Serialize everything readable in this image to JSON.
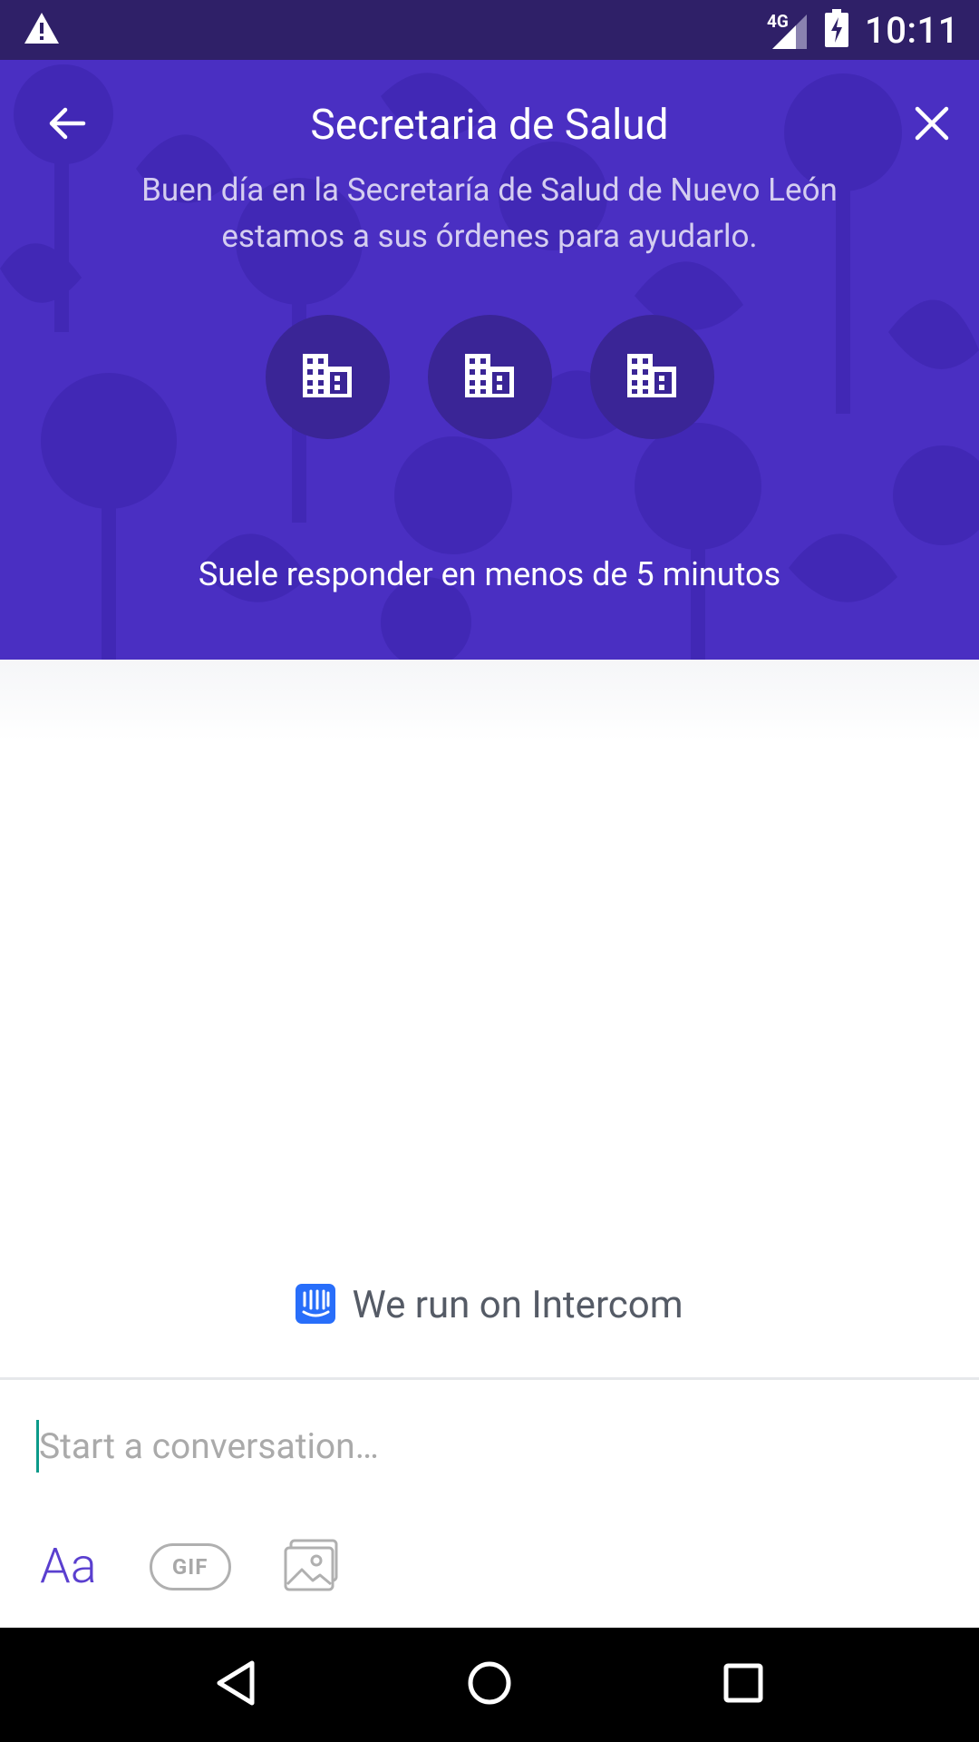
{
  "status_bar": {
    "time": "10:11",
    "network": "4G",
    "icons": [
      "warning-icon",
      "signal-icon",
      "battery-charging-icon"
    ]
  },
  "header": {
    "title": "Secretaria de Salud",
    "intro": "Buen día en la Secretaría de Salud de Nuevo León estamos a sus órdenes para ayudarlo.",
    "response_time": "Suele responder en menos de 5 minutos",
    "avatars": [
      {
        "icon": "building-icon"
      },
      {
        "icon": "building-icon"
      },
      {
        "icon": "building-icon"
      }
    ],
    "background_color": "#4a2fc2",
    "back_icon": "arrow-back-icon",
    "close_icon": "close-icon"
  },
  "conversation": {
    "powered_by": "We run on Intercom",
    "brand_color": "#286efa"
  },
  "composer": {
    "placeholder": "Start a conversation…",
    "text_tool_label": "Aa",
    "gif_label": "GIF",
    "image_icon": "image-icon",
    "accent_color": "#5a3fcf"
  },
  "nav_bar": {
    "buttons": [
      "back-triangle-icon",
      "home-circle-icon",
      "recents-square-icon"
    ]
  }
}
